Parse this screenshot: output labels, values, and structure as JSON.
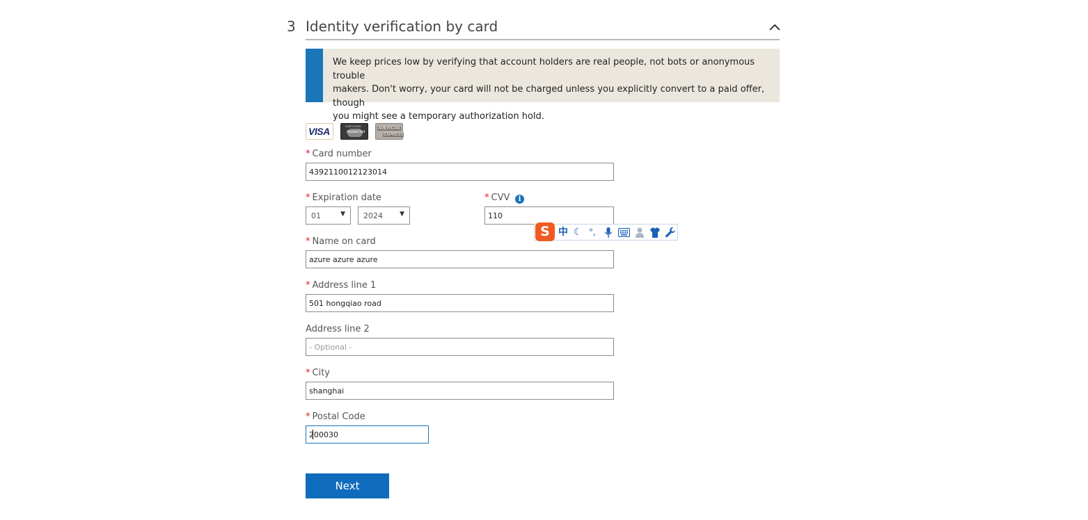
{
  "section": {
    "number": "3",
    "title": "Identity verification by card",
    "collapse_icon": "chevron-up-icon"
  },
  "notice": {
    "line1": "We keep prices low by verifying that account holders are real people, not bots or anonymous trouble",
    "line2": "makers. Don't worry, your card will not be charged unless you explicitly convert to a paid offer, though",
    "line3": "you might see a temporary authorization hold.",
    "accent_color": "#1a75b9",
    "background_color": "#ece7de"
  },
  "cards": {
    "visa": "VISA",
    "mastercard_top": "EUROCARD",
    "mastercard_bottom": "MasterCard",
    "amex_top": "AMERICAN",
    "amex_bottom": "EXPRESS"
  },
  "form": {
    "required_marker": "*",
    "card_number": {
      "label": "Card number",
      "value": "4392110012123014"
    },
    "expiration": {
      "label": "Expiration date",
      "month": "01",
      "year": "2024"
    },
    "cvv": {
      "label": "CVV",
      "value": "110",
      "info_glyph": "i"
    },
    "name": {
      "label": "Name on card",
      "value": "azure azure azure"
    },
    "address1": {
      "label": "Address line 1",
      "value": "501 hongqiao road"
    },
    "address2": {
      "label": "Address line 2",
      "value": "",
      "placeholder": "- Optional -"
    },
    "city": {
      "label": "City",
      "value": "shanghai"
    },
    "postal": {
      "label": "Postal Code",
      "value": "200030"
    }
  },
  "ime_toolbar": {
    "logo": "S",
    "mode": "中",
    "icons": [
      "moon-icon",
      "punctuation-icon",
      "microphone-icon",
      "keyboard-icon",
      "user-icon",
      "shirt-icon",
      "wrench-icon"
    ]
  },
  "actions": {
    "next_label": "Next",
    "next_color": "#0f6cbd"
  }
}
